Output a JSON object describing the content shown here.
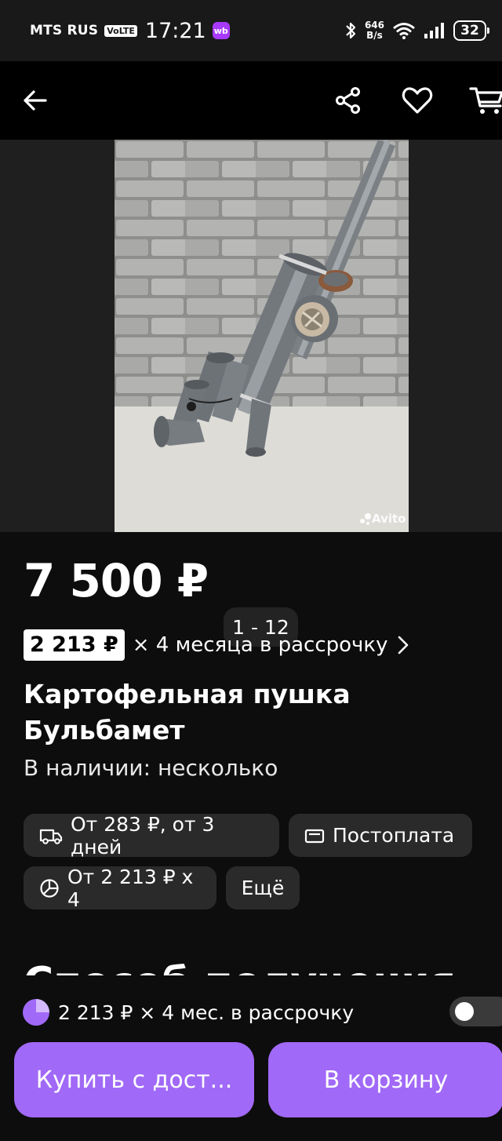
{
  "status_bar": {
    "carrier": "MTS RUS",
    "volte": "VoLTE",
    "time": "17:21",
    "wb_badge": "wb",
    "speed_value": "646",
    "speed_unit": "B/s",
    "battery": "32"
  },
  "app_bar": {
    "icons": [
      "back-arrow-icon",
      "share-icon",
      "heart-icon",
      "cart-icon"
    ]
  },
  "gallery": {
    "counter": "1 - 12",
    "watermark": "Avito"
  },
  "listing": {
    "price": "7 500 ₽",
    "installment_amount": "2 213 ₽",
    "installment_text": "× 4 месяца в рассрочку",
    "title": "Картофельная пушка Бульбамет",
    "availability": "В наличии: несколько"
  },
  "chips": [
    {
      "icon": "truck-icon",
      "label": "От 283 ₽, от 3 дней"
    },
    {
      "icon": "wallet-icon",
      "label": "Постоплата"
    },
    {
      "icon": "pie-chart-icon",
      "label": "От 2 213 ₽ x 4"
    },
    {
      "icon": "",
      "label": "Ещё"
    }
  ],
  "section": {
    "heading": "Способ получения"
  },
  "bottom_panel": {
    "installment_line": "2 213 ₽ × 4 мес. в рассрочку",
    "toggle_on": false,
    "buy_button": "Купить с дост...",
    "cart_button": "В корзину"
  },
  "colors": {
    "accent": "#a169f7",
    "background": "#0d0d0d",
    "chip": "#2a2a2a",
    "wb_purple": "#a73afd"
  }
}
